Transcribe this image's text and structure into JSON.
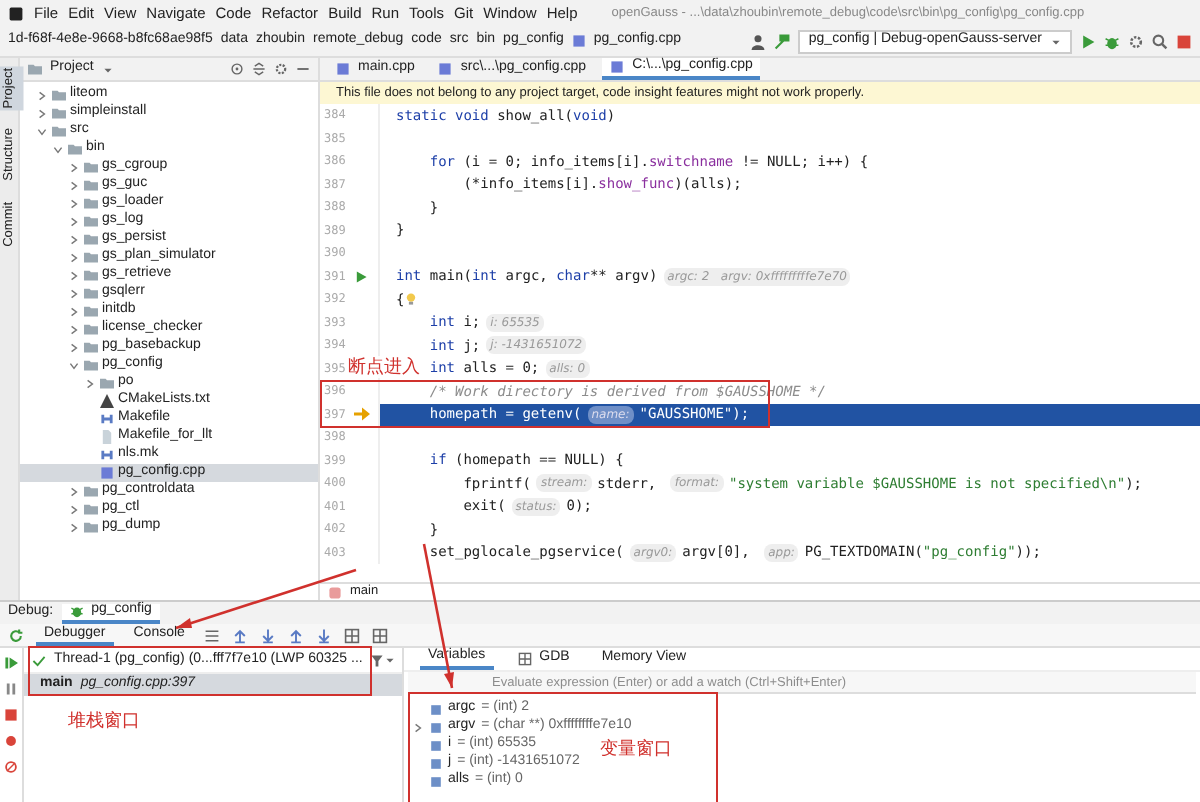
{
  "menu_bar": {
    "items": [
      "File",
      "Edit",
      "View",
      "Navigate",
      "Code",
      "Refactor",
      "Build",
      "Run",
      "Tools",
      "Git",
      "Window",
      "Help"
    ],
    "title": "openGauss - ...\\data\\zhoubin\\remote_debug\\code\\src\\bin\\pg_config\\pg_config.cpp"
  },
  "nav_bar": {
    "breadcrumbs": [
      "1d-f68f-4e8e-9668-b8fc68ae98f5",
      "data",
      "zhoubin",
      "remote_debug",
      "code",
      "src",
      "bin",
      "pg_config",
      "pg_config.cpp"
    ],
    "run_config": "pg_config | Debug-openGauss-server"
  },
  "side_strip": {
    "tabs": [
      {
        "label": "Project",
        "selected": true
      },
      {
        "label": "Structure",
        "selected": false
      },
      {
        "label": "Commit",
        "selected": false
      }
    ]
  },
  "project": {
    "title": "Project",
    "tree": [
      {
        "label": "liteom",
        "kind": "folder",
        "expanded": false
      },
      {
        "label": "simpleinstall",
        "kind": "folder",
        "expanded": false
      },
      {
        "label": "src",
        "kind": "folder",
        "expanded": true,
        "children": [
          {
            "label": "bin",
            "kind": "folder",
            "expanded": true,
            "children": [
              {
                "label": "gs_cgroup",
                "kind": "folder",
                "expanded": false
              },
              {
                "label": "gs_guc",
                "kind": "folder",
                "expanded": false
              },
              {
                "label": "gs_loader",
                "kind": "folder",
                "expanded": false
              },
              {
                "label": "gs_log",
                "kind": "folder",
                "expanded": false
              },
              {
                "label": "gs_persist",
                "kind": "folder",
                "expanded": false
              },
              {
                "label": "gs_plan_simulator",
                "kind": "folder",
                "expanded": false
              },
              {
                "label": "gs_retrieve",
                "kind": "folder",
                "expanded": false
              },
              {
                "label": "gsqlerr",
                "kind": "folder",
                "expanded": false
              },
              {
                "label": "initdb",
                "kind": "folder",
                "expanded": false
              },
              {
                "label": "license_checker",
                "kind": "folder",
                "expanded": false
              },
              {
                "label": "pg_basebackup",
                "kind": "folder",
                "expanded": false
              },
              {
                "label": "pg_config",
                "kind": "folder",
                "expanded": true,
                "children": [
                  {
                    "label": "po",
                    "kind": "folder",
                    "expanded": false
                  },
                  {
                    "label": "CMakeLists.txt",
                    "kind": "cmake",
                    "selected": false
                  },
                  {
                    "label": "Makefile",
                    "kind": "makefile",
                    "selected": false
                  },
                  {
                    "label": "Makefile_for_llt",
                    "kind": "text",
                    "selected": false
                  },
                  {
                    "label": "nls.mk",
                    "kind": "makefile",
                    "selected": false
                  },
                  {
                    "label": "pg_config.cpp",
                    "kind": "cpp",
                    "selected": true
                  }
                ]
              },
              {
                "label": "pg_controldata",
                "kind": "folder",
                "expanded": false
              },
              {
                "label": "pg_ctl",
                "kind": "folder",
                "expanded": false
              },
              {
                "label": "pg_dump",
                "kind": "folder",
                "expanded": false
              }
            ]
          }
        ]
      }
    ]
  },
  "editor": {
    "tabs": [
      {
        "label": "main.cpp",
        "selected": false
      },
      {
        "label": "src\\...\\pg_config.cpp",
        "selected": false
      },
      {
        "label": "C:\\...\\pg_config.cpp",
        "selected": true
      }
    ],
    "notice": "This file does not belong to any project target, code insight features might not work properly.",
    "lines": [
      {
        "number": "384",
        "segments": [
          {
            "kind": "keyword",
            "text": "static void "
          },
          {
            "kind": "plain",
            "text": "show_all("
          },
          {
            "kind": "keyword",
            "text": "void"
          },
          {
            "kind": "plain",
            "text": ")"
          }
        ]
      },
      {
        "number": "385"
      },
      {
        "number": "386",
        "segments": [
          {
            "kind": "keyword",
            "text": "    for "
          },
          {
            "kind": "plain",
            "text": "(i = 0; info_items[i]."
          },
          {
            "kind": "field",
            "text": "switchname"
          },
          {
            "kind": "plain",
            "text": " != NULL; i++) {"
          }
        ]
      },
      {
        "number": "387",
        "segments": [
          {
            "kind": "plain",
            "text": "        (*info_items[i]."
          },
          {
            "kind": "field",
            "text": "show_func"
          },
          {
            "kind": "plain",
            "text": ")(alls);"
          }
        ]
      },
      {
        "number": "388",
        "segments": [
          {
            "kind": "plain",
            "text": "    }"
          }
        ]
      },
      {
        "number": "389",
        "segments": [
          {
            "kind": "plain",
            "text": "}"
          }
        ]
      },
      {
        "number": "390"
      },
      {
        "number": "391",
        "runnable": true,
        "segments": [
          {
            "kind": "keyword",
            "text": "int "
          },
          {
            "kind": "plain",
            "text": "main("
          },
          {
            "kind": "keyword",
            "text": "int "
          },
          {
            "kind": "plain",
            "text": "argc, "
          },
          {
            "kind": "keyword",
            "text": "char"
          },
          {
            "kind": "plain",
            "text": "** argv)"
          },
          {
            "kind": "hint",
            "text": "argc: 2   argv: 0xfffffffffe7e70"
          }
        ]
      },
      {
        "number": "392",
        "bulb": true,
        "segments": [
          {
            "kind": "plain",
            "text": "{"
          }
        ]
      },
      {
        "number": "393",
        "segments": [
          {
            "kind": "keyword",
            "text": "    int "
          },
          {
            "kind": "plain",
            "text": "i;"
          },
          {
            "kind": "hint",
            "text": "i: 65535"
          }
        ]
      },
      {
        "number": "394",
        "segments": [
          {
            "kind": "keyword",
            "text": "    int "
          },
          {
            "kind": "plain",
            "text": "j;"
          },
          {
            "kind": "hint",
            "text": "j: -1431651072"
          }
        ]
      },
      {
        "number": "395",
        "segments": [
          {
            "kind": "keyword",
            "text": "    int "
          },
          {
            "kind": "plain",
            "text": "alls = 0;"
          },
          {
            "kind": "hint",
            "text": "alls: 0"
          }
        ]
      },
      {
        "number": "396",
        "segments": [
          {
            "kind": "comment",
            "text": "    /* Work directory is derived from $GAUSSHOME */"
          }
        ]
      },
      {
        "number": "397",
        "current": true,
        "segments": [
          {
            "kind": "plain",
            "text": "    homepath = getenv("
          },
          {
            "kind": "hint",
            "text": "name:"
          },
          {
            "kind": "string",
            "text": "\"GAUSSHOME\""
          },
          {
            "kind": "plain",
            "text": ");"
          }
        ]
      },
      {
        "number": "398"
      },
      {
        "number": "399",
        "segments": [
          {
            "kind": "keyword",
            "text": "    if "
          },
          {
            "kind": "plain",
            "text": "(homepath == NULL) {"
          }
        ]
      },
      {
        "number": "400",
        "segments": [
          {
            "kind": "plain",
            "text": "        fprintf("
          },
          {
            "kind": "hint",
            "text": "stream:"
          },
          {
            "kind": "plain",
            "text": "stderr, "
          },
          {
            "kind": "hint",
            "text": "format:"
          },
          {
            "kind": "string",
            "text": "\"system variable $GAUSSHOME is not specified\\n\""
          },
          {
            "kind": "plain",
            "text": ");"
          }
        ]
      },
      {
        "number": "401",
        "segments": [
          {
            "kind": "plain",
            "text": "        exit("
          },
          {
            "kind": "hint",
            "text": "status:"
          },
          {
            "kind": "plain",
            "text": "0);"
          }
        ]
      },
      {
        "number": "402",
        "segments": [
          {
            "kind": "plain",
            "text": "    }"
          }
        ]
      },
      {
        "number": "403",
        "segments": [
          {
            "kind": "plain",
            "text": "    set_pglocale_pgservice("
          },
          {
            "kind": "hint",
            "text": "argv0:"
          },
          {
            "kind": "plain",
            "text": "argv[0], "
          },
          {
            "kind": "hint",
            "text": "app:"
          },
          {
            "kind": "plain",
            "text": "PG_TEXTDOMAIN("
          },
          {
            "kind": "string",
            "text": "\"pg_config\""
          },
          {
            "kind": "plain",
            "text": "));"
          }
        ]
      }
    ],
    "breadcrumb": "main",
    "annotation_label": "断点进入"
  },
  "debug": {
    "label": "Debug:",
    "session": "pg_config",
    "tabs": [
      {
        "label": "Debugger",
        "selected": true
      },
      {
        "label": "Console",
        "selected": false
      }
    ],
    "thread": "Thread-1 (pg_config) (0...fff7f7e10 (LWP 60325 ...",
    "frames": [
      {
        "function": "main",
        "location": "pg_config.cpp:397",
        "selected": true
      }
    ],
    "frames_annotation": "堆栈窗口",
    "view_tabs": [
      {
        "label": "Variables",
        "selected": true
      },
      {
        "label": "GDB",
        "selected": false
      },
      {
        "label": "Memory View",
        "selected": false
      }
    ],
    "evaluate": {
      "placeholder": "Evaluate expression (Enter) or add a watch (Ctrl+Shift+Enter)"
    },
    "variables": [
      {
        "name": "argc",
        "value": "= (int) 2",
        "expandable": false
      },
      {
        "name": "argv",
        "value": "= (char **) 0xffffffffe7e10",
        "expandable": true
      },
      {
        "name": "i",
        "value": "= (int) 65535",
        "expandable": false
      },
      {
        "name": "j",
        "value": "= (int) -1431651072",
        "expandable": false
      },
      {
        "name": "alls",
        "value": "= (int) 0",
        "expandable": false
      }
    ],
    "variables_annotation": "变量窗口"
  }
}
